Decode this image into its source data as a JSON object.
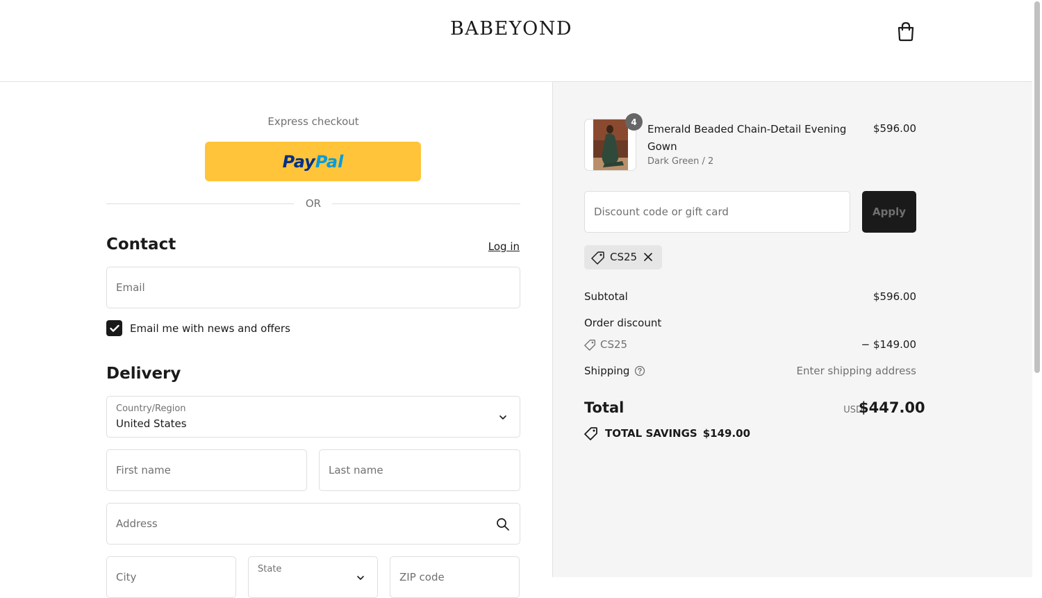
{
  "header": {
    "brand": "BABEYOND",
    "cart_icon": "shopping-bag-icon"
  },
  "express": {
    "label": "Express checkout",
    "paypal_part1": "Pay",
    "paypal_part2": "Pal",
    "or_label": "OR"
  },
  "contact": {
    "title": "Contact",
    "login_label": "Log in",
    "email_placeholder": "Email",
    "newsletter_label": "Email me with news and offers",
    "newsletter_checked": true
  },
  "delivery": {
    "title": "Delivery",
    "country_label": "Country/Region",
    "country_value": "United States",
    "first_name_placeholder": "First name",
    "last_name_placeholder": "Last name",
    "address_placeholder": "Address",
    "city_placeholder": "City",
    "state_label": "State",
    "zip_placeholder": "ZIP code"
  },
  "order": {
    "item": {
      "quantity": "4",
      "name": "Emerald Beaded Chain-Detail Evening Gown",
      "variant": "Dark Green / 2",
      "price": "$596.00"
    },
    "discount_placeholder": "Discount code or gift card",
    "apply_label": "Apply",
    "applied_code": "CS25",
    "subtotal_label": "Subtotal",
    "subtotal_value": "$596.00",
    "order_discount_label": "Order discount",
    "discount_code": "CS25",
    "discount_value": "− $149.00",
    "shipping_label": "Shipping",
    "shipping_value": "Enter shipping address",
    "total_label": "Total",
    "total_currency": "USD",
    "total_value": "$447.00",
    "savings_label": "TOTAL SAVINGS",
    "savings_value": "$149.00"
  },
  "colors": {
    "paypal_yellow": "#ffc439",
    "apply_button": "#1a1a1a",
    "summary_bg": "#f5f5f5"
  }
}
